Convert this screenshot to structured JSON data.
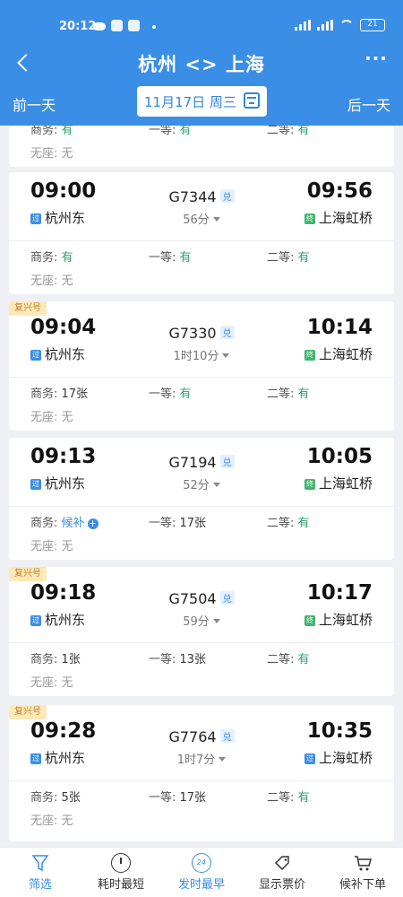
{
  "status": {
    "time": "20:12",
    "battery": "21"
  },
  "nav": {
    "title": "杭州 <> 上海",
    "more": "···"
  },
  "datebar": {
    "prev": "前一天",
    "date": "11月17日 周三",
    "next": "后一天"
  },
  "badges": {
    "pass": "过",
    "end": "终",
    "dui": "兑"
  },
  "seat_labels": {
    "business": "商务: ",
    "first": "一等: ",
    "second": "二等: ",
    "none": "无座: "
  },
  "trains": [
    {
      "partial": true,
      "first": "有",
      "second": "有",
      "business": "有",
      "noseat": "无"
    },
    {
      "tag": "",
      "dep": "09:00",
      "arr": "09:56",
      "no": "G7344",
      "dur": "56分",
      "from": "杭州东",
      "from_badge": "过",
      "to": "上海虹桥",
      "to_badge": "终",
      "business": "有",
      "first": "有",
      "second": "有",
      "noseat": "无"
    },
    {
      "tag": "复兴号",
      "dep": "09:04",
      "arr": "10:14",
      "no": "G7330",
      "dur": "1时10分",
      "from": "杭州东",
      "from_badge": "过",
      "to": "上海虹桥",
      "to_badge": "终",
      "business": "17张",
      "first": "有",
      "second": "有",
      "noseat": "无"
    },
    {
      "tag": "",
      "dep": "09:13",
      "arr": "10:05",
      "no": "G7194",
      "dur": "52分",
      "from": "杭州东",
      "from_badge": "过",
      "to": "上海虹桥",
      "to_badge": "终",
      "business": "候补",
      "first": "17张",
      "second": "有",
      "noseat": "无"
    },
    {
      "tag": "复兴号",
      "dep": "09:18",
      "arr": "10:17",
      "no": "G7504",
      "dur": "59分",
      "from": "杭州东",
      "from_badge": "过",
      "to": "上海虹桥",
      "to_badge": "终",
      "business": "1张",
      "first": "13张",
      "second": "有",
      "noseat": "无"
    },
    {
      "tag": "复兴号",
      "dep": "09:28",
      "arr": "10:35",
      "no": "G7764",
      "dur": "1时7分",
      "from": "杭州东",
      "from_badge": "过",
      "to": "上海虹桥",
      "to_badge": "过",
      "business": "5张",
      "first": "17张",
      "second": "有",
      "noseat": "无"
    }
  ],
  "tabs": [
    {
      "label": "筛选",
      "icon": "filter-icon"
    },
    {
      "label": "耗时最短",
      "icon": "clock-icon"
    },
    {
      "label": "发时最早",
      "icon": "24-icon",
      "badge": "24"
    },
    {
      "label": "显示票价",
      "icon": "price-tag-icon"
    },
    {
      "label": "候补下单",
      "icon": "cart-icon"
    }
  ]
}
